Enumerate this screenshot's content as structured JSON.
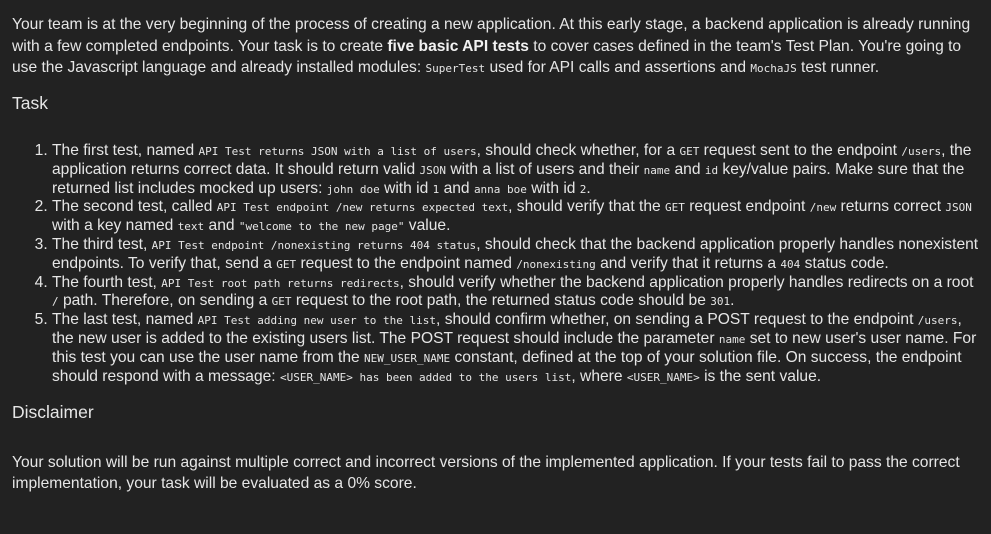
{
  "intro": {
    "t1": "Your team is at the very beginning of the process of creating a new application. At this early stage, a backend application is already running with a few completed endpoints. Your task is to create ",
    "bold": "five basic API tests",
    "t2": " to cover cases defined in the team's Test Plan. You're going to use the Javascript language and already installed modules: ",
    "c1": "SuperTest",
    "t3": " used for API calls and assertions and ",
    "c2": "MochaJS",
    "t4": " test runner."
  },
  "task_heading": "Task",
  "items": [
    {
      "t1": "The first test, named ",
      "c1": "API Test returns JSON with a list of users",
      "t2": ", should check whether, for a ",
      "c2": "GET",
      "t3": " request sent to the endpoint ",
      "c3": "/users",
      "t4": ", the application returns correct data. It should return valid ",
      "c4": "JSON",
      "t5": " with a list of users and their ",
      "c5": "name",
      "t6": " and ",
      "c6": "id",
      "t7": " key/value pairs. Make sure that the returned list includes mocked up users: ",
      "c7": "john doe",
      "t8": " with id ",
      "c8": "1",
      "t9": " and ",
      "c9": "anna boe",
      "t10": " with id ",
      "c10": "2",
      "t11": "."
    },
    {
      "t1": "The second test, called ",
      "c1": "API Test endpoint /new returns expected text",
      "t2": ", should verify that the ",
      "c2": "GET",
      "t3": " request endpoint ",
      "c3": "/new",
      "t4": " returns correct ",
      "c4": "JSON",
      "t5": " with a key named ",
      "c5": "text",
      "t6": " and ",
      "c6": "\"welcome to the new page\"",
      "t7": " value."
    },
    {
      "t1": "The third test, ",
      "c1": "API Test endpoint /nonexisting returns 404 status",
      "t2": ", should check that the backend application properly handles nonexistent endpoints. To verify that, send a ",
      "c2": "GET",
      "t3": " request to the endpoint named ",
      "c3": "/nonexisting",
      "t4": " and verify that it returns a ",
      "c4": "404",
      "t5": " status code."
    },
    {
      "t1": "The fourth test, ",
      "c1": "API Test root path returns redirects",
      "t2": ", should verify whether the backend application properly handles redirects on a root ",
      "c2": "/",
      "t3": " path. Therefore, on sending a ",
      "c3": "GET",
      "t4": " request to the root path, the returned status code should be ",
      "c4": "301",
      "t5": "."
    },
    {
      "t1": "The last test, named ",
      "c1": "API Test adding new user to the list",
      "t2": ", should confirm whether, on sending a POST request to the endpoint ",
      "c2": "/users",
      "t3": ", the new user is added to the existing users list. The POST request should include the parameter ",
      "c3": "name",
      "t4": " set to new user's user name. For this test you can use the user name from the ",
      "c4": "NEW_USER_NAME",
      "t5": " constant, defined at the top of your solution file. On success, the endpoint should respond with a message: ",
      "c5": "<USER_NAME> has been added to the users list",
      "t6": ", where ",
      "c6": "<USER_NAME>",
      "t7": " is the sent value."
    }
  ],
  "disclaimer_heading": "Disclaimer",
  "disclaimer_text": "Your solution will be run against multiple correct and incorrect versions of the implemented application. If your tests fail to pass the correct implementation, your task will be evaluated as a 0% score."
}
